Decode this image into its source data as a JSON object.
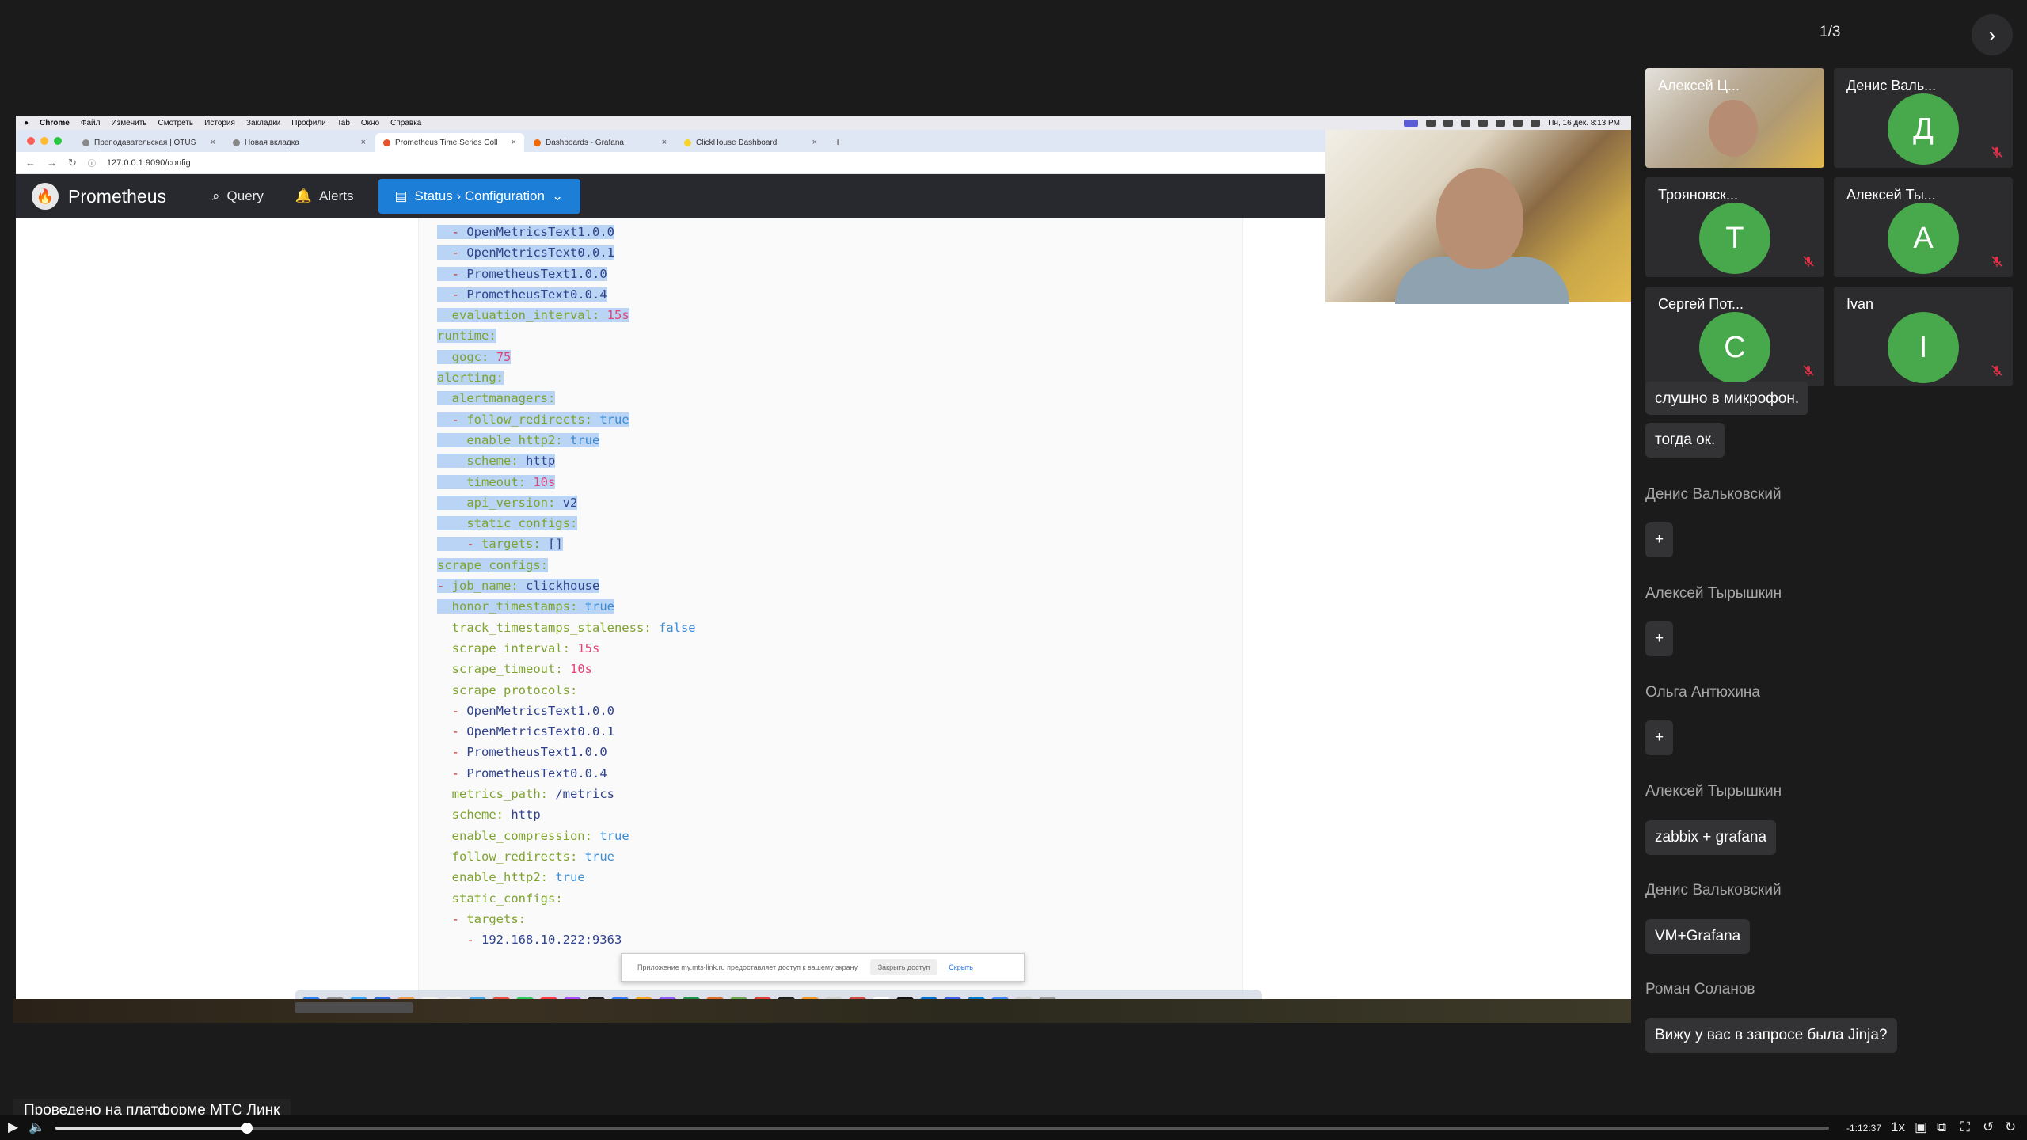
{
  "mac_menu": {
    "items": [
      "Chrome",
      "Файл",
      "Изменить",
      "Смотреть",
      "История",
      "Закладки",
      "Профили",
      "Tab",
      "Окно",
      "Справка"
    ],
    "clock": "Пн, 16 дек. 8:13 PM"
  },
  "browser": {
    "tabs": [
      {
        "label": "Преподавательская | OTUS",
        "active": false
      },
      {
        "label": "Новая вкладка",
        "active": false
      },
      {
        "label": "Prometheus Time Series Coll",
        "active": true
      },
      {
        "label": "Dashboards - Grafana",
        "active": false
      },
      {
        "label": "ClickHouse Dashboard",
        "active": false
      }
    ],
    "url": "127.0.0.1:9090/config"
  },
  "prometheus": {
    "brand": "Prometheus",
    "nav": {
      "query": "Query",
      "alerts": "Alerts",
      "status": "Status › Configuration"
    }
  },
  "config_lines": [
    "  - OpenMetricsText1.0.0",
    "  - OpenMetricsText0.0.1",
    "  - PrometheusText1.0.0",
    "  - PrometheusText0.0.4",
    "  evaluation_interval: 15s",
    "runtime:",
    "  gogc: 75",
    "alerting:",
    "  alertmanagers:",
    "  - follow_redirects: true",
    "    enable_http2: true",
    "    scheme: http",
    "    timeout: 10s",
    "    api_version: v2",
    "    static_configs:",
    "    - targets: []",
    "scrape_configs:",
    "- job_name: clickhouse",
    "  honor_timestamps: true",
    "  track_timestamps_staleness: false",
    "  scrape_interval: 15s",
    "  scrape_timeout: 10s",
    "  scrape_protocols:",
    "  - OpenMetricsText1.0.0",
    "  - OpenMetricsText0.0.1",
    "  - PrometheusText1.0.0",
    "  - PrometheusText0.0.4",
    "  metrics_path: /metrics",
    "  scheme: http",
    "  enable_compression: true",
    "  follow_redirects: true",
    "  enable_http2: true",
    "  static_configs:",
    "  - targets:",
    "    - 192.168.10.222:9363"
  ],
  "selected_line_count": 19,
  "screen_share_notice": {
    "text": "Приложение my.mts-link.ru предоставляет доступ к вашему экрану.",
    "stop": "Закрыть доступ",
    "hide": "Скрыть"
  },
  "conference": {
    "page_indicator": "1/3",
    "participants": [
      {
        "name": "Алексей Ц...",
        "initial": "",
        "video": true,
        "muted": false
      },
      {
        "name": "Денис Валь...",
        "initial": "Д",
        "video": false,
        "muted": true
      },
      {
        "name": "Трояновск...",
        "initial": "Т",
        "video": false,
        "muted": true
      },
      {
        "name": "Алексей Ты...",
        "initial": "А",
        "video": false,
        "muted": true
      },
      {
        "name": "Сергей Пот...",
        "initial": "С",
        "video": false,
        "muted": true
      },
      {
        "name": "Ivan",
        "initial": "I",
        "video": false,
        "muted": true
      }
    ],
    "colors": {
      "avatar": "#48a84c",
      "mute": "#e0304a",
      "highlight": "#b9d4f5",
      "status_nav": "#1c7ed6"
    }
  },
  "chat": [
    {
      "author": "",
      "text": "слушно в микрофон."
    },
    {
      "author": "",
      "text": "тогда ок."
    },
    {
      "author": "Денис Вальковский",
      "text": "+"
    },
    {
      "author": "Алексей Тырышкин",
      "text": "+"
    },
    {
      "author": "Ольга Антюхина",
      "text": "+"
    },
    {
      "author": "Алексей Тырышкин",
      "text": "zabbix + grafana"
    },
    {
      "author": "Денис Вальковский",
      "text": "VM+Grafana"
    },
    {
      "author": "Роман Соланов",
      "text": "Вижу у вас в запросе была Jinja?"
    }
  ],
  "player": {
    "platform_label": "Проведено на платформе МТС Линк",
    "time_remaining": "-1:12:37",
    "speed": "1x",
    "progress": 0.108
  }
}
